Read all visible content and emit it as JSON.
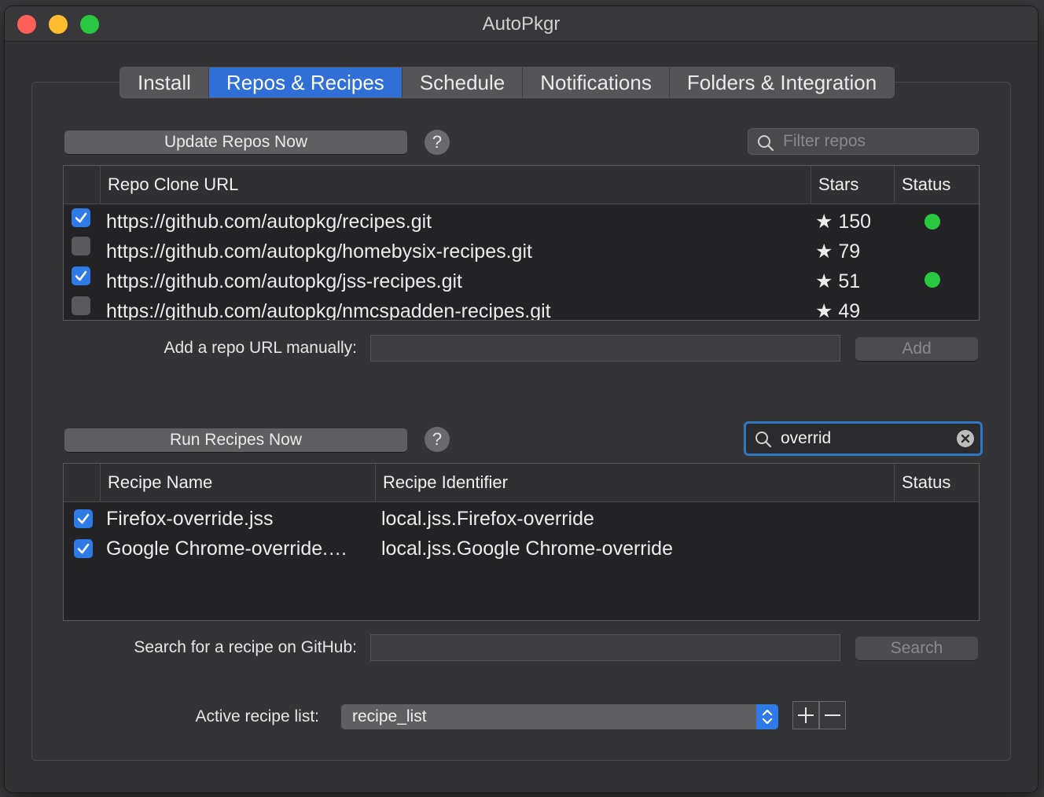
{
  "window": {
    "title": "AutoPkgr"
  },
  "tabs": [
    {
      "label": "Install",
      "active": false
    },
    {
      "label": "Repos & Recipes",
      "active": true
    },
    {
      "label": "Schedule",
      "active": false
    },
    {
      "label": "Notifications",
      "active": false
    },
    {
      "label": "Folders & Integration",
      "active": false
    }
  ],
  "repos": {
    "update_button": "Update Repos Now",
    "help": "?",
    "filter_placeholder": "Filter repos",
    "columns": {
      "url": "Repo Clone URL",
      "stars": "Stars",
      "status": "Status"
    },
    "rows": [
      {
        "checked": true,
        "url": "https://github.com/autopkg/recipes.git",
        "stars": "150",
        "status": "ok"
      },
      {
        "checked": false,
        "url": "https://github.com/autopkg/homebysix-recipes.git",
        "stars": "79",
        "status": ""
      },
      {
        "checked": true,
        "url": "https://github.com/autopkg/jss-recipes.git",
        "stars": "51",
        "status": "ok"
      },
      {
        "checked": false,
        "url": "https://github.com/autopkg/nmcspadden-recipes.git",
        "stars": "49",
        "status": ""
      }
    ],
    "add_label": "Add a repo URL manually:",
    "add_value": "",
    "add_button": "Add"
  },
  "recipes": {
    "run_button": "Run Recipes Now",
    "help": "?",
    "search_value": "overrid",
    "columns": {
      "name": "Recipe Name",
      "identifier": "Recipe Identifier",
      "status": "Status"
    },
    "rows": [
      {
        "checked": true,
        "name": "Firefox-override.jss",
        "identifier": "local.jss.Firefox-override"
      },
      {
        "checked": true,
        "name": "Google Chrome-override.…",
        "identifier": "local.jss.Google Chrome-override"
      }
    ],
    "github_label": "Search for a recipe on GitHub:",
    "github_value": "",
    "search_button": "Search",
    "active_list_label": "Active recipe list:",
    "active_list_value": "recipe_list"
  },
  "colors": {
    "accent": "#2e7ae6",
    "status_ok": "#28c840",
    "focus_ring": "#2f77c5"
  }
}
